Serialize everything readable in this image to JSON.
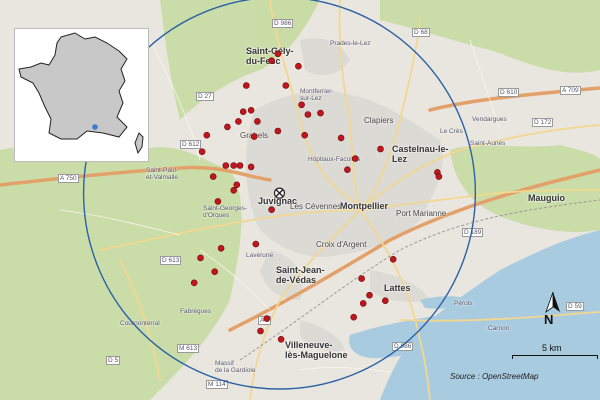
{
  "map": {
    "colors": {
      "water": "#a9cbe0",
      "land": "#e9e6df",
      "green": "#c8dca4",
      "urban": "#dcdad5",
      "motorway": "#e3a068",
      "primary": "#f2d78f",
      "circle": "#2b62a7",
      "point": "#c0161c"
    },
    "labels": [
      {
        "key": "saint-gely",
        "text": "Saint-Gély-\ndu-Fesc"
      },
      {
        "key": "castelnau",
        "text": "Castelnau-le-\nLez"
      },
      {
        "key": "juvignac",
        "text": "Juvignac"
      },
      {
        "key": "montpellier",
        "text": "Montpellier"
      },
      {
        "key": "saint-jean",
        "text": "Saint-Jean-\nde-Védas"
      },
      {
        "key": "lattes",
        "text": "Lattes"
      },
      {
        "key": "villeneuve",
        "text": "Villeneuve-\nlès-Maguelone"
      },
      {
        "key": "mauguio",
        "text": "Mauguio"
      },
      {
        "key": "grabels",
        "text": "Grabels"
      },
      {
        "key": "clapiers",
        "text": "Clapiers"
      },
      {
        "key": "les-cevennes",
        "text": "Les Cévennes"
      },
      {
        "key": "croix-argent",
        "text": "Croix d'Argent"
      },
      {
        "key": "port-marianne",
        "text": "Port Marianne"
      },
      {
        "key": "saint-georges",
        "text": "Saint-Georges-\nd'Orques"
      },
      {
        "key": "lavérune",
        "text": "Lavérune"
      },
      {
        "key": "pérols",
        "text": "Pérols"
      },
      {
        "key": "saint-aunes",
        "text": "Saint-Aunès"
      },
      {
        "key": "saint-paul",
        "text": "Saint-Paul-\net-Valmalle"
      },
      {
        "key": "cournonterral",
        "text": "Cournonterral"
      },
      {
        "key": "fabregues",
        "text": "Fabrègues"
      },
      {
        "key": "massif",
        "text": "Massif\nde la Gardiole"
      },
      {
        "key": "vendargues",
        "text": "Vendargues"
      },
      {
        "key": "le-cres",
        "text": "Le Crès"
      },
      {
        "key": "carnon",
        "text": "Carnon"
      },
      {
        "key": "montferrier",
        "text": "Montferrier-\nsur-Lez"
      },
      {
        "key": "prades",
        "text": "Prades-le-Lez"
      },
      {
        "key": "hopitaux",
        "text": "Hôpitaux-Facultés"
      }
    ],
    "road_labels": [
      "A 750",
      "A 709",
      "A 9",
      "D 986",
      "D 68",
      "D 613",
      "M 613",
      "D 5",
      "D 189",
      "D 986",
      "D 59",
      "D 172",
      "D 610",
      "D 612",
      "D 27",
      "M 114"
    ],
    "points": [
      {
        "x": 3.876,
        "y": 43.711
      },
      {
        "x": 3.872,
        "y": 43.706
      },
      {
        "x": 3.889,
        "y": 43.702
      },
      {
        "x": 3.856,
        "y": 43.688
      },
      {
        "x": 3.881,
        "y": 43.688
      },
      {
        "x": 3.895,
        "y": 43.667
      },
      {
        "x": 3.903,
        "y": 43.668
      },
      {
        "x": 3.891,
        "y": 43.674
      },
      {
        "x": 3.859,
        "y": 43.67
      },
      {
        "x": 3.854,
        "y": 43.669
      },
      {
        "x": 3.844,
        "y": 43.658
      },
      {
        "x": 3.851,
        "y": 43.662
      },
      {
        "x": 3.863,
        "y": 43.662
      },
      {
        "x": 3.876,
        "y": 43.655
      },
      {
        "x": 3.893,
        "y": 43.652
      },
      {
        "x": 3.861,
        "y": 43.651
      },
      {
        "x": 3.831,
        "y": 43.652
      },
      {
        "x": 3.828,
        "y": 43.64
      },
      {
        "x": 3.843,
        "y": 43.63
      },
      {
        "x": 3.848,
        "y": 43.63
      },
      {
        "x": 3.852,
        "y": 43.63
      },
      {
        "x": 3.859,
        "y": 43.629
      },
      {
        "x": 3.835,
        "y": 43.622
      },
      {
        "x": 3.85,
        "y": 43.616
      },
      {
        "x": 3.848,
        "y": 43.612
      },
      {
        "x": 3.838,
        "y": 43.604
      },
      {
        "x": 3.916,
        "y": 43.65
      },
      {
        "x": 3.941,
        "y": 43.642
      },
      {
        "x": 3.925,
        "y": 43.635
      },
      {
        "x": 3.92,
        "y": 43.627
      },
      {
        "x": 3.977,
        "y": 43.625
      },
      {
        "x": 3.978,
        "y": 43.622
      },
      {
        "x": 3.872,
        "y": 43.598
      },
      {
        "x": 3.862,
        "y": 43.573
      },
      {
        "x": 3.84,
        "y": 43.57
      },
      {
        "x": 3.827,
        "y": 43.563
      },
      {
        "x": 3.836,
        "y": 43.553
      },
      {
        "x": 3.823,
        "y": 43.545
      },
      {
        "x": 3.949,
        "y": 43.562
      },
      {
        "x": 3.929,
        "y": 43.548
      },
      {
        "x": 3.934,
        "y": 43.536
      },
      {
        "x": 3.944,
        "y": 43.532
      },
      {
        "x": 3.924,
        "y": 43.52
      },
      {
        "x": 3.93,
        "y": 43.53
      },
      {
        "x": 3.869,
        "y": 43.519
      },
      {
        "x": 3.865,
        "y": 43.51
      },
      {
        "x": 3.878,
        "y": 43.504
      }
    ],
    "center": {
      "x": 3.877,
      "y": 43.61
    },
    "radius_km": 10
  },
  "inset": {
    "title": "France",
    "marker_color": "#3a7bd5"
  },
  "north_label": "N",
  "scale_label": "5 km",
  "source_label": "Source : OpenStreetMap"
}
